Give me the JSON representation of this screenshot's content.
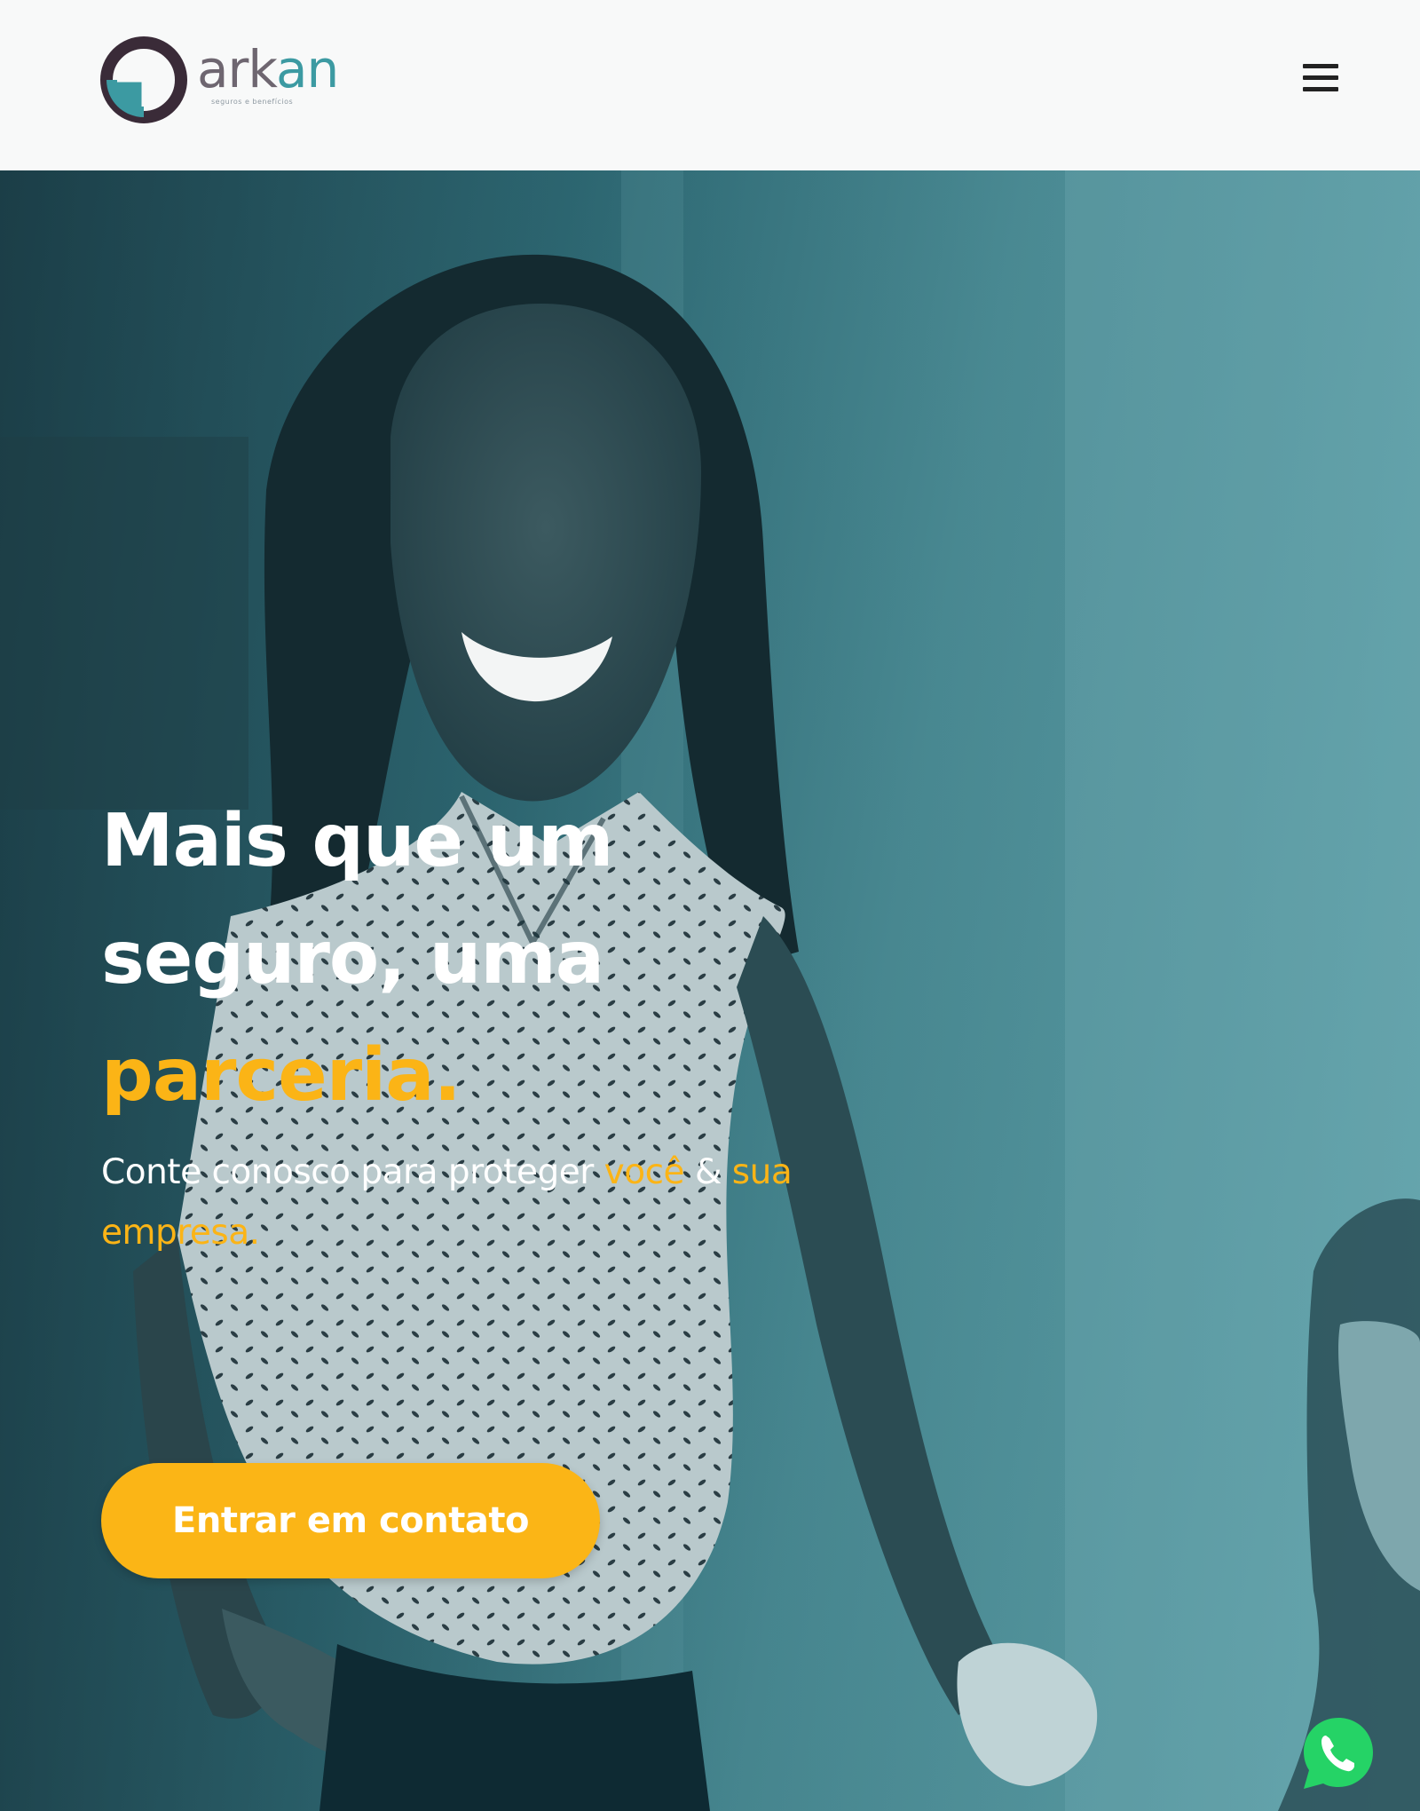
{
  "header": {
    "logo": {
      "word_part1": "ark",
      "word_part2": "an",
      "tagline": "seguros e benefícios",
      "colors": {
        "ring": "#3a2b38",
        "accent": "#3c9aa2",
        "word": "#6e6670"
      }
    },
    "menu_icon": "hamburger-menu-icon"
  },
  "hero": {
    "headline_line1": "Mais que um",
    "headline_line2": "seguro, uma",
    "headline_accent": "parceria.",
    "subline_prefix": "Conte conosco para proteger",
    "subline_accent1": "você",
    "subline_amp": "&",
    "subline_accent2": "sua empresa.",
    "cta_label": "Entrar em contato",
    "colors": {
      "accent": "#fbb416",
      "overlay": "#2e6a75",
      "text": "#ffffff"
    }
  },
  "floating": {
    "whatsapp_icon": "whatsapp-icon",
    "color": "#25d366"
  }
}
